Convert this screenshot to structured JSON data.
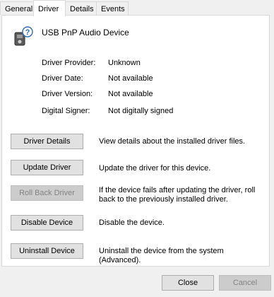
{
  "tabs": [
    "General",
    "Driver",
    "Details",
    "Events"
  ],
  "device": {
    "name": "USB PnP Audio Device",
    "icon": "audio-device-icon"
  },
  "properties": [
    {
      "label": "Driver Provider:",
      "value": "Unknown"
    },
    {
      "label": "Driver Date:",
      "value": "Not available"
    },
    {
      "label": "Driver Version:",
      "value": "Not available"
    },
    {
      "label": "Digital Signer:",
      "value": "Not digitally signed"
    }
  ],
  "actions": [
    {
      "label": "Driver Details",
      "description": "View details about the installed driver files.",
      "enabled": true
    },
    {
      "label": "Update Driver",
      "description": "Update the driver for this device.",
      "enabled": true
    },
    {
      "label": "Roll Back Driver",
      "description": "If the device fails after updating the driver, roll back to the previously installed driver.",
      "enabled": false
    },
    {
      "label": "Disable Device",
      "description": "Disable the device.",
      "enabled": true
    },
    {
      "label": "Uninstall Device",
      "description": "Uninstall the device from the system (Advanced).",
      "enabled": true
    }
  ],
  "footer": {
    "close_label": "Close",
    "cancel_label": "Cancel"
  }
}
